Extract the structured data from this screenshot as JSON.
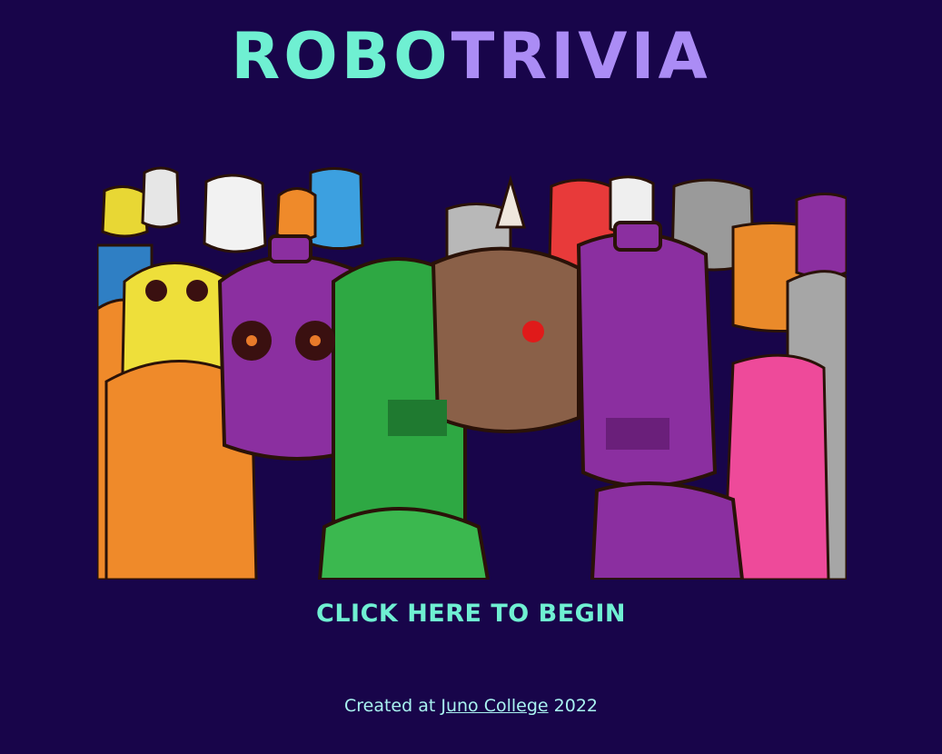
{
  "header": {
    "title_part1": "ROBO",
    "title_part2": "TRIVIA"
  },
  "hero": {
    "illustration": "crowd of colorful cartoon robots"
  },
  "start": {
    "label": "CLICK HERE TO BEGIN"
  },
  "footer": {
    "prefix": "Created at ",
    "link_label": "Juno College",
    "year": " 2022"
  },
  "colors": {
    "background": "#18054a",
    "accent_teal": "#6ff0d2",
    "accent_purple": "#ab8cf5",
    "footer_text": "#a9f3f0"
  }
}
